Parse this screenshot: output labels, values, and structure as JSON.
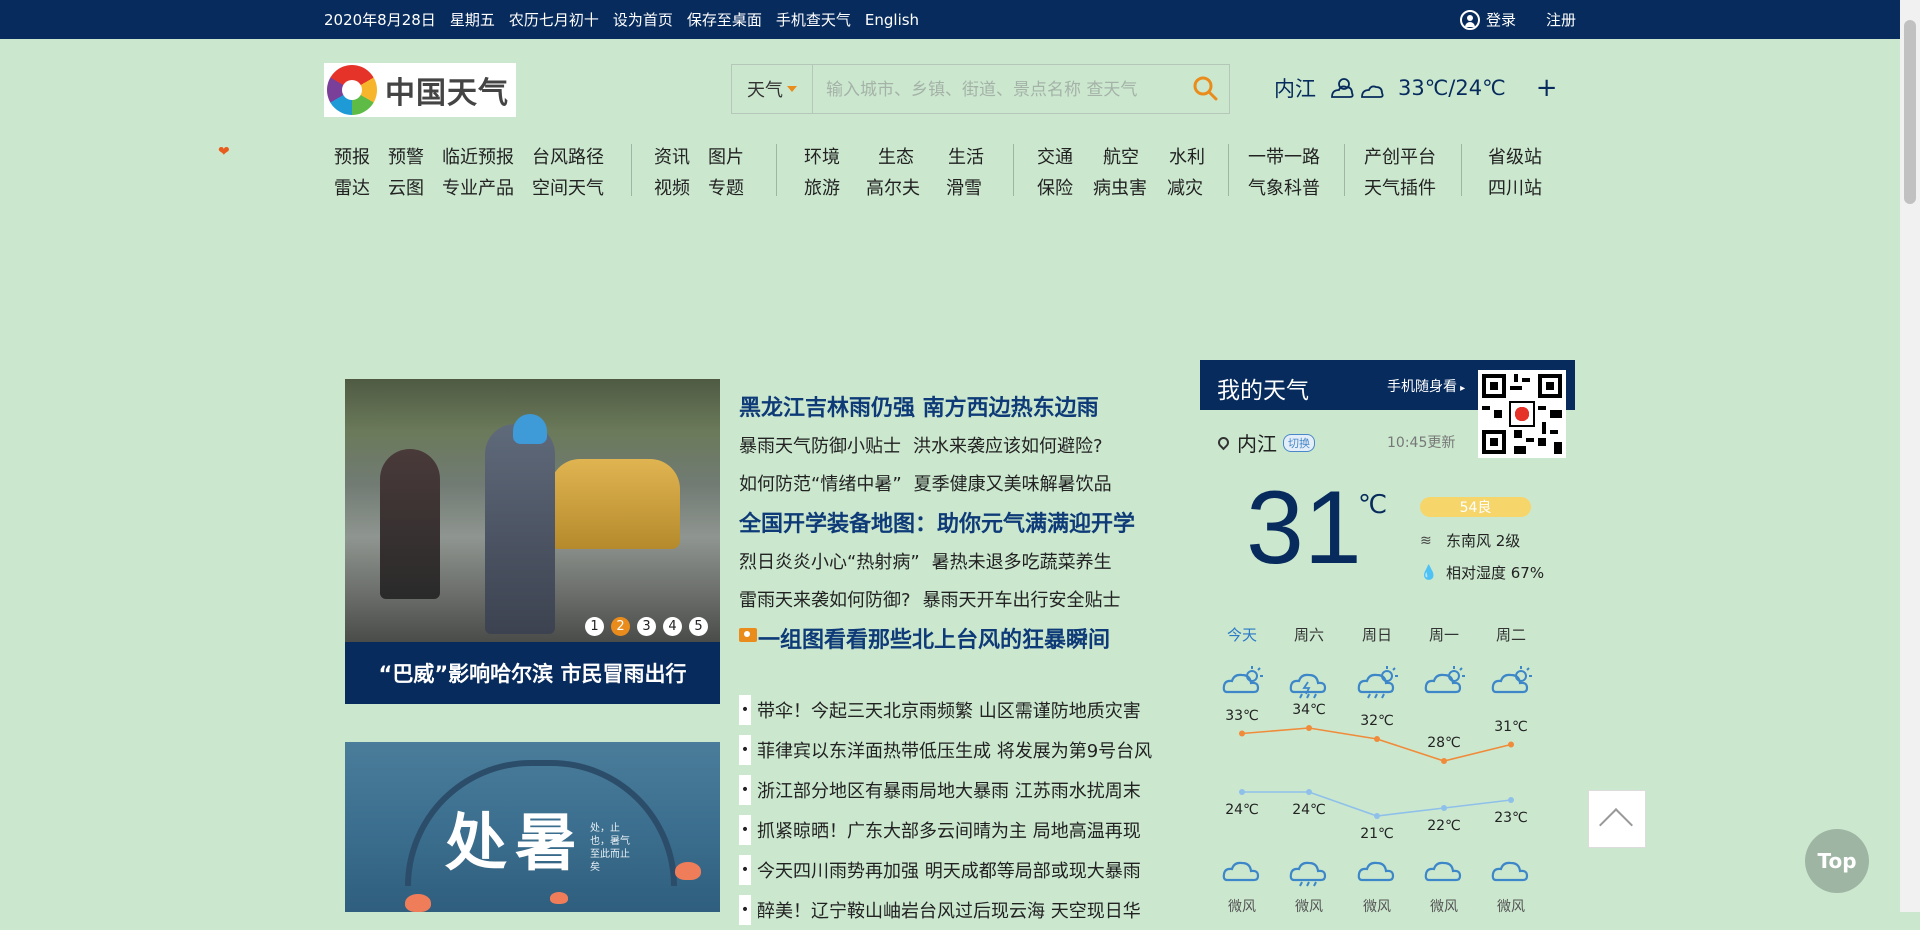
{
  "topbar": {
    "links": [
      "2020年8月28日",
      "星期五",
      "农历七月初十",
      "设为首页",
      "保存至桌面",
      "手机查天气",
      "English"
    ],
    "login": "登录",
    "register": "注册"
  },
  "logo": {
    "text": "中国天气"
  },
  "search": {
    "type_label": "天气",
    "placeholder": "输入城市、乡镇、街道、景点名称 查天气"
  },
  "header_weather": {
    "city": "内江",
    "temp_range": "33℃/24℃",
    "add": "+"
  },
  "nav": {
    "groups": [
      {
        "row1": [
          "预报",
          "预警",
          "临近预报",
          "台风路径"
        ],
        "row2": [
          "雷达",
          "云图",
          "专业产品",
          "空间天气"
        ]
      },
      {
        "row1": [
          "资讯",
          "图片"
        ],
        "row2": [
          "视频",
          "专题"
        ]
      },
      {
        "row1": [
          "环境",
          "生态",
          "生活"
        ],
        "row2": [
          "旅游",
          "高尔夫",
          "滑雪"
        ]
      },
      {
        "row1": [
          "交通",
          "航空",
          "水利"
        ],
        "row2": [
          "保险",
          "病虫害",
          "减灾"
        ]
      },
      {
        "row1": [
          "一带一路"
        ],
        "row2": [
          "气象科普"
        ]
      },
      {
        "row1": [
          "产创平台"
        ],
        "row2": [
          "天气插件"
        ]
      },
      {
        "row1": [
          "省级站"
        ],
        "row2": [
          "四川站"
        ]
      }
    ]
  },
  "hero": {
    "caption": "“巴威”影响哈尔滨 市民冒雨出行",
    "dots": [
      "1",
      "2",
      "3",
      "4",
      "5"
    ],
    "active_dot": 2
  },
  "hero2": {
    "title": "处暑",
    "text": "处，止也，暑气至此而止矣"
  },
  "headlines": [
    {
      "type": "big",
      "text": "黑龙江吉林雨仍强 南方西边热东边雨"
    },
    {
      "type": "sub",
      "items": [
        "暴雨天气防御小贴士",
        "洪水来袭应该如何避险?"
      ]
    },
    {
      "type": "sub",
      "items": [
        "如何防范“情绪中暑”",
        "夏季健康又美味解暑饮品"
      ]
    },
    {
      "type": "big",
      "text": "全国开学装备地图：助你元气满满迎开学"
    },
    {
      "type": "sub",
      "items": [
        "烈日炎炎小心“热射病”",
        "暑热未退多吃蔬菜养生"
      ]
    },
    {
      "type": "sub",
      "items": [
        "雷雨天来袭如何防御?",
        "暴雨天开车出行安全贴士"
      ]
    },
    {
      "type": "photo",
      "text": "一组图看看那些北上台风的狂暴瞬间"
    }
  ],
  "bullets": [
    "带伞！今起三天北京雨频繁 山区需谨防地质灾害",
    "菲律宾以东洋面热带低压生成 将发展为第9号台风",
    "浙江部分地区有暴雨局地大暴雨  江苏雨水扰周末",
    "抓紧晾晒！广东大部多云间晴为主 局地高温再现",
    "今天四川雨势再加强 明天成都等局部或现大暴雨",
    "醉美！辽宁鞍山岫岩台风过后现云海 天空现日华"
  ],
  "my_weather": {
    "title": "我的天气",
    "mobile": "手机随身看",
    "city": "内江",
    "switch": "切换",
    "updated": "10:45更新",
    "current_temp": "31",
    "unit": "℃",
    "aqi": "54良",
    "wind": "东南风  2级",
    "humidity": "相对湿度  67%"
  },
  "forecast": {
    "days": [
      "今天",
      "周六",
      "周日",
      "周一",
      "周二"
    ],
    "icons_day": [
      "partly-cloudy-sun-icon",
      "thunder-rain-icon",
      "rain-sun-icon",
      "partly-cloudy-sun-icon",
      "partly-cloudy-sun-icon"
    ],
    "icons_night": [
      "cloudy-night-icon",
      "rain-night-icon",
      "cloudy-night-icon",
      "cloudy-night-icon",
      "cloudy-night-icon"
    ],
    "highs": [
      33,
      34,
      32,
      28,
      31
    ],
    "highs_text": [
      "33℃",
      "34℃",
      "32℃",
      "28℃",
      "31℃"
    ],
    "lows": [
      24,
      24,
      21,
      22,
      23
    ],
    "lows_text": [
      "24℃",
      "24℃",
      "21℃",
      "22℃",
      "23℃"
    ],
    "wind": [
      "微风",
      "微风",
      "微风",
      "微风",
      "微风"
    ],
    "high_color": "#f08b3a",
    "low_color": "#8fc0ea"
  },
  "totop": {
    "label": "Top"
  },
  "colors": {
    "topbar": "#072b5c",
    "background": "#cbe8cf",
    "accent": "#e98c1c",
    "headline": "#0e3b78"
  }
}
